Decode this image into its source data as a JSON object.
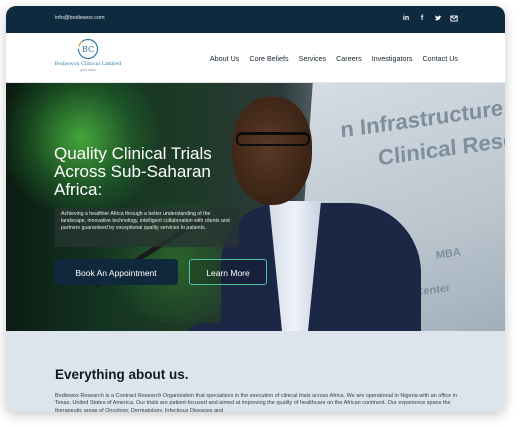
{
  "topbar": {
    "email": "info@bodiewox.com",
    "socials": [
      "linkedin-icon",
      "facebook-icon",
      "twitter-icon",
      "mail-icon"
    ]
  },
  "header": {
    "logo": {
      "mark": "BC",
      "brand": "Bodiewox Clinical Limited",
      "tag": "gold class"
    },
    "nav": [
      "About Us",
      "Core Beliefs",
      "Services",
      "Careers",
      "Investigators",
      "Contact Us"
    ]
  },
  "hero": {
    "title": "Quality Clinical Trials Across Sub-Saharan Africa:",
    "description": "Achieving a healthier Africa through a better understanding of the landscape, innovative technology, intelligent collaboration with clients and partners guaranteed by exceptional quality services to patients.",
    "primary_button": "Book An Appointment",
    "secondary_button": "Learn More",
    "background_text": [
      "n Infrastructure to P",
      "Clinical Resea",
      "MBA",
      "r Center"
    ]
  },
  "about": {
    "heading": "Everything about us.",
    "body": "Bodiewox Research is a Contract Research Organization that specializes in the execution of clinical trials across Africa. We are operational in Nigeria with an office in Texas, United States of America. Our trials are patient-focused and aimed at improving the quality of healthcare on the African continent. Our experience spans the therapeutic areas of Oncology, Dermatology, Infectious Diseases and"
  },
  "colors": {
    "topbar": "#0d2a3f",
    "primary_button": "#10283c",
    "outline_accent": "#4fc3a1",
    "about_bg": "#dde4ec"
  }
}
